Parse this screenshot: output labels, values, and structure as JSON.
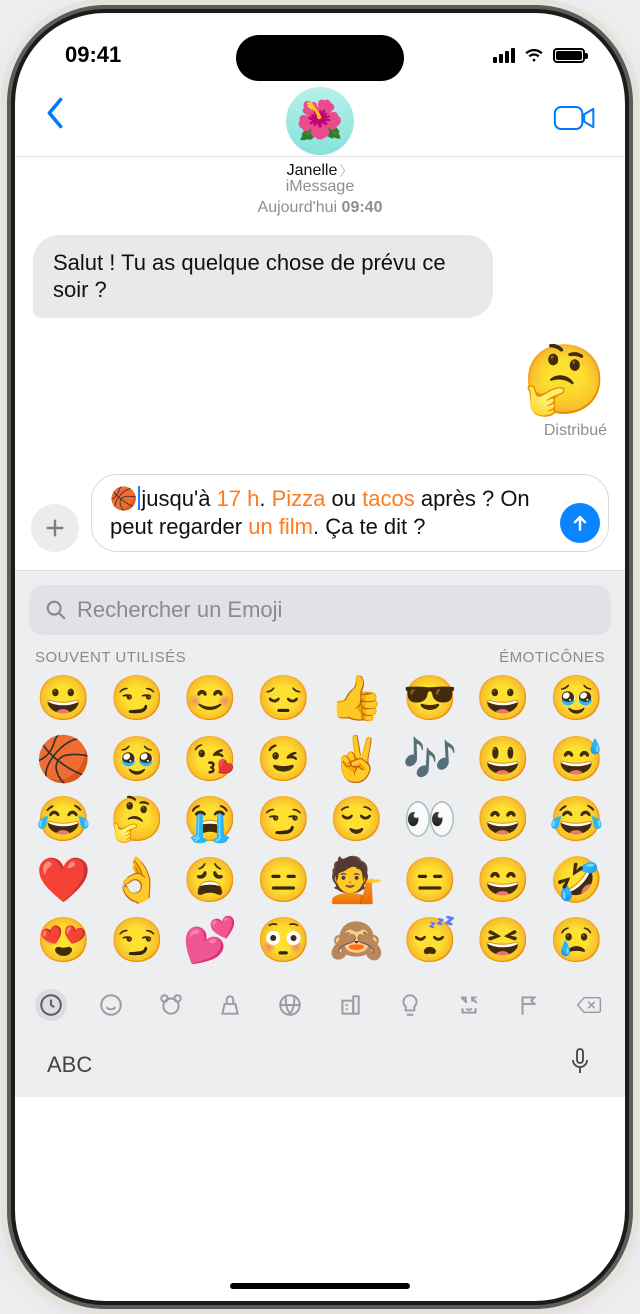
{
  "status": {
    "time": "09:41"
  },
  "header": {
    "contact_name": "Janelle",
    "avatar_emoji": "🌺"
  },
  "thread": {
    "service": "iMessage",
    "timestamp_prefix": "Aujourd'hui",
    "timestamp_time": "09:40",
    "incoming": "Salut ! Tu as quelque chose de prévu ce soir ?",
    "sent_emoji": "🤔",
    "delivered_label": "Distribué"
  },
  "composer": {
    "segments": {
      "p1": "🏀",
      "p2": "jusqu'à ",
      "h1": "17 h",
      "p3": ". ",
      "h2": "Pizza",
      "p4": " ou ",
      "h3": "tacos",
      "p5": " après ? On peut regarder ",
      "h4": "un film",
      "p6": ". Ça te dit ?"
    }
  },
  "keyboard": {
    "search_placeholder": "Rechercher un Emoji",
    "section_left": "SOUVENT UTILISÉS",
    "section_right": "ÉMOTICÔNES",
    "abc_label": "ABC",
    "emojis": [
      "😀",
      "😏",
      "😊",
      "😔",
      "👍",
      "😎",
      "😀",
      "🥹",
      "🏀",
      "🥹",
      "😘",
      "😉",
      "✌️",
      "🎶",
      "😃",
      "😅",
      "😂",
      "🤔",
      "😭",
      "😏",
      "😌",
      "👀",
      "😄",
      "😂",
      "❤️",
      "👌",
      "😩",
      "😑",
      "💁",
      "😑",
      "😄",
      "🤣",
      "😍",
      "😏",
      "💕",
      "😳",
      "🙈",
      "😴",
      "😆",
      "😢"
    ]
  }
}
